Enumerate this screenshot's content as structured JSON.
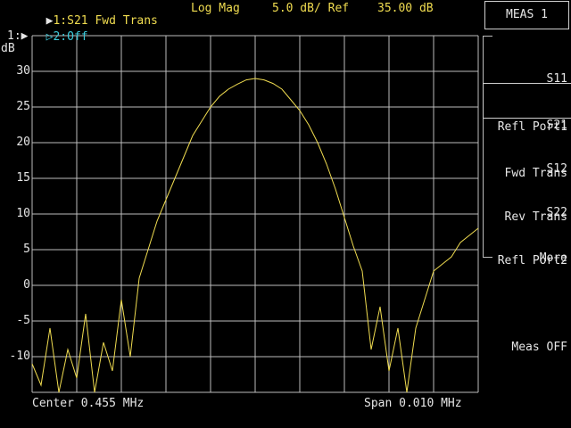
{
  "header": {
    "trace1_marker": "▶",
    "trace1_label": "1:S21 Fwd Trans",
    "format": "Log Mag",
    "scale": "5.0 dB/ Ref",
    "ref_value": "35.00 dB",
    "trace2_marker": "▷",
    "trace2_label": "2:Off"
  },
  "axis": {
    "trace_ref": "1:▶",
    "unit": "dB",
    "tick_labels": [
      "30",
      "25",
      "20",
      "15",
      "10",
      "5",
      "0",
      "-5",
      "-10"
    ]
  },
  "footer": {
    "center": "Center 0.455 MHz",
    "span": "Span 0.010 MHz"
  },
  "menu": {
    "title": "MEAS 1",
    "items": [
      {
        "line1": "S11",
        "line2": "Refl Port1"
      },
      {
        "line1": "S21",
        "line2": "Fwd Trans"
      },
      {
        "line1": "S12",
        "line2": "Rev Trans"
      },
      {
        "line1": "S22",
        "line2": "Refl Port2"
      },
      {
        "line1": "More",
        "line2": ""
      },
      {
        "line1": "Meas OFF",
        "line2": ""
      }
    ]
  },
  "colors": {
    "trace": "#f0dc50",
    "grid": "#bdbdbd",
    "trace2": "#3cc8d8",
    "background": "#000000"
  },
  "chart_data": {
    "type": "line",
    "xlabel": "",
    "ylabel": "dB",
    "xlim": [
      0.45,
      0.46
    ],
    "ylim": [
      -15,
      35
    ],
    "series": [
      {
        "x": [
          0.45,
          0.4502,
          0.4504,
          0.4506,
          0.4508,
          0.451,
          0.4512,
          0.4514,
          0.4516,
          0.4518,
          0.452,
          0.4522,
          0.4524,
          0.4526,
          0.4528,
          0.453,
          0.4532,
          0.4534,
          0.4536,
          0.4538,
          0.454,
          0.4542,
          0.4544,
          0.4546,
          0.4548,
          0.455,
          0.4552,
          0.4554,
          0.4556,
          0.4558,
          0.456,
          0.4562,
          0.4564,
          0.4566,
          0.4568,
          0.457,
          0.4572,
          0.4574,
          0.4576,
          0.4578,
          0.458,
          0.4582,
          0.4584,
          0.4586,
          0.4588,
          0.459,
          0.4592,
          0.4594,
          0.4596,
          0.4598,
          0.46
        ],
        "y": [
          -11,
          -14,
          -6,
          -15,
          -9,
          -13,
          -4,
          -15,
          -8,
          -12,
          -2,
          -10,
          1,
          5,
          9,
          12,
          15,
          18,
          21,
          23,
          25,
          26.5,
          27.5,
          28.2,
          28.8,
          29.0,
          28.8,
          28.3,
          27.5,
          26,
          24.5,
          22.5,
          20,
          17,
          13.5,
          9.5,
          5.5,
          2,
          -9,
          -3,
          -12,
          -6,
          -15,
          -6,
          -2,
          2,
          3,
          4,
          6,
          7,
          8
        ]
      }
    ]
  }
}
